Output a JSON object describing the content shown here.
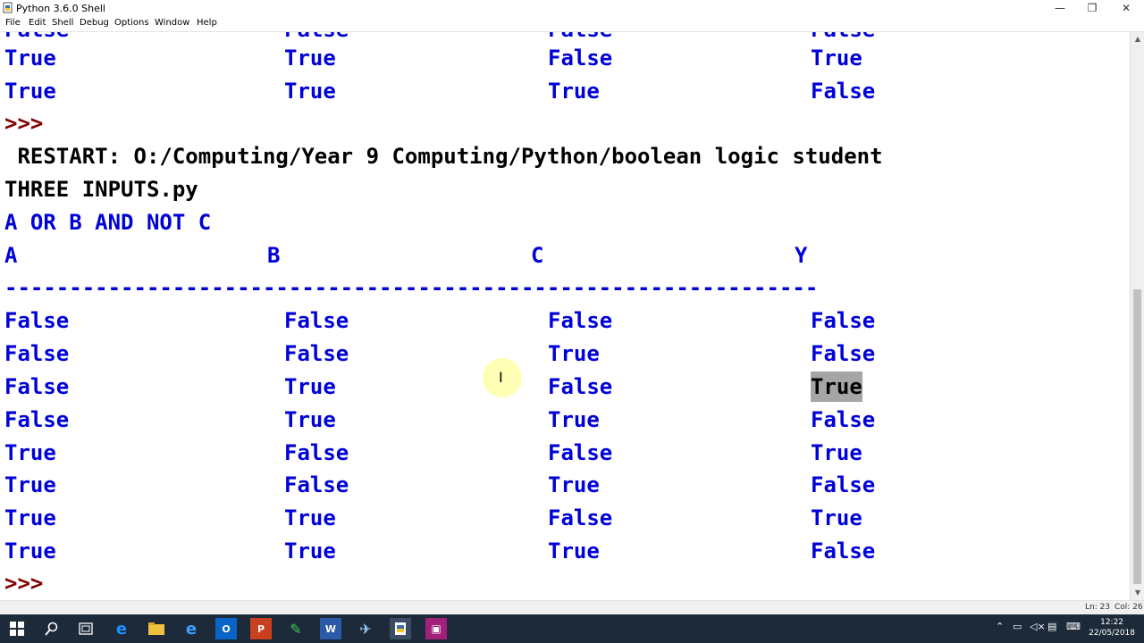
{
  "window": {
    "title": "Python 3.6.0 Shell",
    "minimize_glyph": "—",
    "maximize_glyph": "❐",
    "close_glyph": "✕"
  },
  "menu": [
    "File",
    "Edit",
    "Shell",
    "Debug",
    "Options",
    "Window",
    "Help"
  ],
  "shell": {
    "prev_rows": [
      [
        "True",
        "True",
        "False",
        "True"
      ],
      [
        "True",
        "True",
        "True",
        "False"
      ]
    ],
    "prompt": ">>>",
    "restart_line1": " RESTART: O:/Computing/Year 9 Computing/Python/boolean logic student",
    "restart_line2": "THREE INPUTS.py",
    "expression": "A OR B AND NOT C",
    "headers": [
      "A",
      "B",
      "C",
      "Y"
    ],
    "separator": "---------------------------------------------------------------",
    "rows": [
      [
        "False",
        "False",
        "False",
        "False"
      ],
      [
        "False",
        "False",
        "True",
        "False"
      ],
      [
        "False",
        "True",
        "False",
        "True"
      ],
      [
        "False",
        "True",
        "True",
        "False"
      ],
      [
        "True",
        "False",
        "False",
        "True"
      ],
      [
        "True",
        "False",
        "True",
        "False"
      ],
      [
        "True",
        "True",
        "False",
        "True"
      ],
      [
        "True",
        "True",
        "True",
        "False"
      ]
    ],
    "prompt_end": ">>>"
  },
  "status": {
    "line": "Ln: 23",
    "col": "Col: 26"
  },
  "taskbar": {
    "time": "12:22",
    "date": "22/05/2018"
  },
  "colors": {
    "output_blue": "#0000d8",
    "prompt_maroon": "#800000",
    "selection_grey": "#a5a5a5",
    "taskbar": "#1d2a3a"
  }
}
